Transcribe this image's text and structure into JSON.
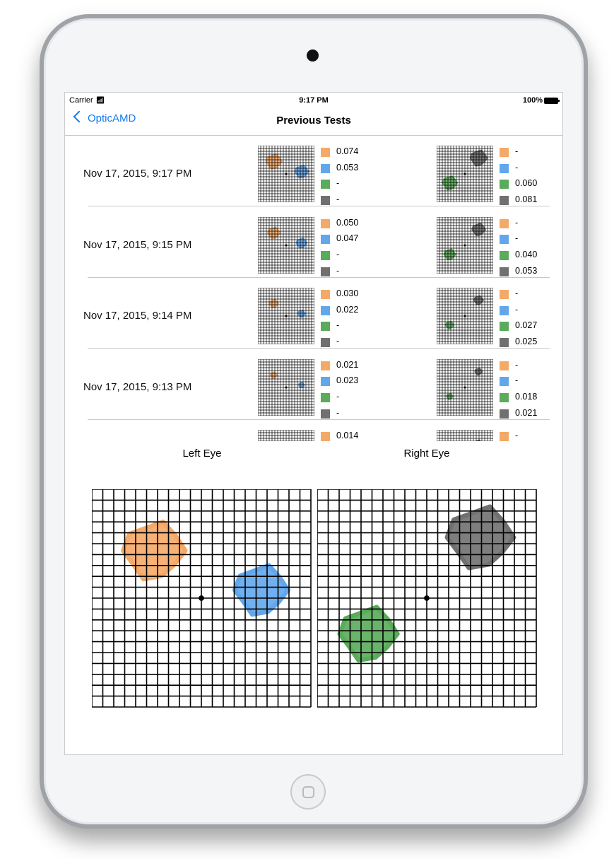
{
  "status_bar": {
    "carrier": "Carrier",
    "time": "9:17 PM",
    "battery": "100%"
  },
  "nav": {
    "back_label": "OpticAMD",
    "title": "Previous Tests"
  },
  "colors": {
    "orange": "#f5a967",
    "blue": "#62a6ec",
    "green": "#5aab5a",
    "gray": "#707070",
    "accent": "#1478f2"
  },
  "tests": [
    {
      "date": "Nov 17, 2015, 9:17 PM",
      "left": [
        "0.074",
        "0.053",
        "-",
        "-"
      ],
      "right": [
        "-",
        "-",
        "0.060",
        "0.081"
      ]
    },
    {
      "date": "Nov 17, 2015, 9:15 PM",
      "left": [
        "0.050",
        "0.047",
        "-",
        "-"
      ],
      "right": [
        "-",
        "-",
        "0.040",
        "0.053"
      ]
    },
    {
      "date": "Nov 17, 2015, 9:14 PM",
      "left": [
        "0.030",
        "0.022",
        "-",
        "-"
      ],
      "right": [
        "-",
        "-",
        "0.027",
        "0.025"
      ]
    },
    {
      "date": "Nov 17, 2015, 9:13 PM",
      "left": [
        "0.021",
        "0.023",
        "-",
        "-"
      ],
      "right": [
        "-",
        "-",
        "0.018",
        "0.021"
      ]
    },
    {
      "date": "",
      "left": [
        "0.014",
        "",
        "",
        ""
      ],
      "right": [
        "-",
        "",
        "",
        ""
      ]
    }
  ],
  "detail": {
    "left_label": "Left Eye",
    "right_label": "Right Eye"
  }
}
